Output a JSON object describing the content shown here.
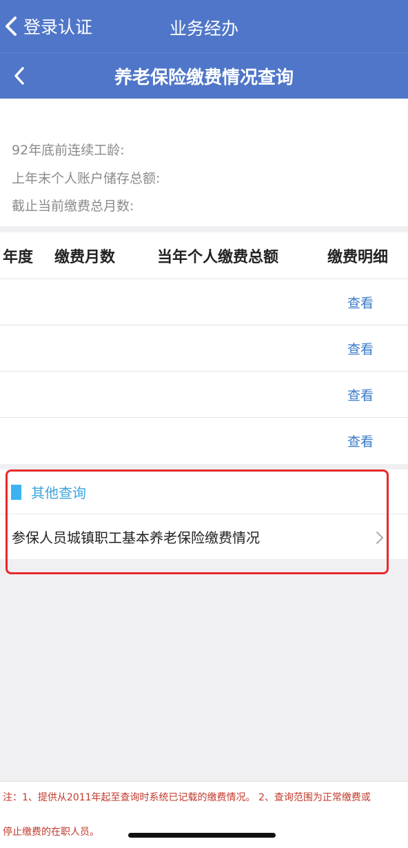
{
  "topbar": {
    "back_label": "登录认证",
    "title": "业务经办"
  },
  "navbar": {
    "title": "养老保险缴费情况查询"
  },
  "info": {
    "line1": "92年底前连续工龄:",
    "line2": "上年末个人账户储存总额:",
    "line3": "截止当前缴费总月数:"
  },
  "table": {
    "headers": [
      "年度",
      "缴费月数",
      "当年个人缴费总额",
      "缴费明细"
    ],
    "rows": [
      {
        "action": "查看"
      },
      {
        "action": "查看"
      },
      {
        "action": "查看"
      },
      {
        "action": "查看"
      }
    ]
  },
  "other": {
    "title": "其他查询",
    "item": "参保人员城镇职工基本养老保险缴费情况"
  },
  "note": {
    "line1": "注：1、提供从2011年起至查询时系统已记载的缴费情况。 2、查询范围为正常缴费或",
    "line2": "停止缴费的在职人员。"
  },
  "colors": {
    "header_bg": "#4f76c8",
    "link": "#3a7bc8",
    "accent": "#3cb3f0",
    "highlight": "#e8282b",
    "note": "#c0392b"
  },
  "icons": {
    "back": "chevron-left-icon",
    "item": "chevron-right-icon"
  }
}
